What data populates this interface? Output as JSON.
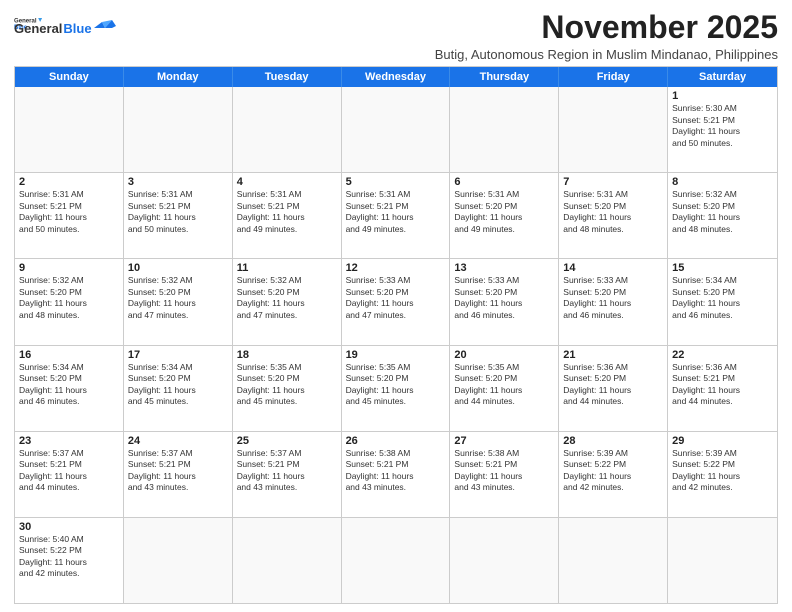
{
  "logo": {
    "line1": "General",
    "line2": "Blue"
  },
  "title": "November 2025",
  "subtitle": "Butig, Autonomous Region in Muslim Mindanao, Philippines",
  "header_days": [
    "Sunday",
    "Monday",
    "Tuesday",
    "Wednesday",
    "Thursday",
    "Friday",
    "Saturday"
  ],
  "weeks": [
    [
      {
        "day": "",
        "text": ""
      },
      {
        "day": "",
        "text": ""
      },
      {
        "day": "",
        "text": ""
      },
      {
        "day": "",
        "text": ""
      },
      {
        "day": "",
        "text": ""
      },
      {
        "day": "",
        "text": ""
      },
      {
        "day": "1",
        "text": "Sunrise: 5:30 AM\nSunset: 5:21 PM\nDaylight: 11 hours\nand 50 minutes."
      }
    ],
    [
      {
        "day": "2",
        "text": "Sunrise: 5:31 AM\nSunset: 5:21 PM\nDaylight: 11 hours\nand 50 minutes."
      },
      {
        "day": "3",
        "text": "Sunrise: 5:31 AM\nSunset: 5:21 PM\nDaylight: 11 hours\nand 50 minutes."
      },
      {
        "day": "4",
        "text": "Sunrise: 5:31 AM\nSunset: 5:21 PM\nDaylight: 11 hours\nand 49 minutes."
      },
      {
        "day": "5",
        "text": "Sunrise: 5:31 AM\nSunset: 5:21 PM\nDaylight: 11 hours\nand 49 minutes."
      },
      {
        "day": "6",
        "text": "Sunrise: 5:31 AM\nSunset: 5:20 PM\nDaylight: 11 hours\nand 49 minutes."
      },
      {
        "day": "7",
        "text": "Sunrise: 5:31 AM\nSunset: 5:20 PM\nDaylight: 11 hours\nand 48 minutes."
      },
      {
        "day": "8",
        "text": "Sunrise: 5:32 AM\nSunset: 5:20 PM\nDaylight: 11 hours\nand 48 minutes."
      }
    ],
    [
      {
        "day": "9",
        "text": "Sunrise: 5:32 AM\nSunset: 5:20 PM\nDaylight: 11 hours\nand 48 minutes."
      },
      {
        "day": "10",
        "text": "Sunrise: 5:32 AM\nSunset: 5:20 PM\nDaylight: 11 hours\nand 47 minutes."
      },
      {
        "day": "11",
        "text": "Sunrise: 5:32 AM\nSunset: 5:20 PM\nDaylight: 11 hours\nand 47 minutes."
      },
      {
        "day": "12",
        "text": "Sunrise: 5:33 AM\nSunset: 5:20 PM\nDaylight: 11 hours\nand 47 minutes."
      },
      {
        "day": "13",
        "text": "Sunrise: 5:33 AM\nSunset: 5:20 PM\nDaylight: 11 hours\nand 46 minutes."
      },
      {
        "day": "14",
        "text": "Sunrise: 5:33 AM\nSunset: 5:20 PM\nDaylight: 11 hours\nand 46 minutes."
      },
      {
        "day": "15",
        "text": "Sunrise: 5:34 AM\nSunset: 5:20 PM\nDaylight: 11 hours\nand 46 minutes."
      }
    ],
    [
      {
        "day": "16",
        "text": "Sunrise: 5:34 AM\nSunset: 5:20 PM\nDaylight: 11 hours\nand 46 minutes."
      },
      {
        "day": "17",
        "text": "Sunrise: 5:34 AM\nSunset: 5:20 PM\nDaylight: 11 hours\nand 45 minutes."
      },
      {
        "day": "18",
        "text": "Sunrise: 5:35 AM\nSunset: 5:20 PM\nDaylight: 11 hours\nand 45 minutes."
      },
      {
        "day": "19",
        "text": "Sunrise: 5:35 AM\nSunset: 5:20 PM\nDaylight: 11 hours\nand 45 minutes."
      },
      {
        "day": "20",
        "text": "Sunrise: 5:35 AM\nSunset: 5:20 PM\nDaylight: 11 hours\nand 44 minutes."
      },
      {
        "day": "21",
        "text": "Sunrise: 5:36 AM\nSunset: 5:20 PM\nDaylight: 11 hours\nand 44 minutes."
      },
      {
        "day": "22",
        "text": "Sunrise: 5:36 AM\nSunset: 5:21 PM\nDaylight: 11 hours\nand 44 minutes."
      }
    ],
    [
      {
        "day": "23",
        "text": "Sunrise: 5:37 AM\nSunset: 5:21 PM\nDaylight: 11 hours\nand 44 minutes."
      },
      {
        "day": "24",
        "text": "Sunrise: 5:37 AM\nSunset: 5:21 PM\nDaylight: 11 hours\nand 43 minutes."
      },
      {
        "day": "25",
        "text": "Sunrise: 5:37 AM\nSunset: 5:21 PM\nDaylight: 11 hours\nand 43 minutes."
      },
      {
        "day": "26",
        "text": "Sunrise: 5:38 AM\nSunset: 5:21 PM\nDaylight: 11 hours\nand 43 minutes."
      },
      {
        "day": "27",
        "text": "Sunrise: 5:38 AM\nSunset: 5:21 PM\nDaylight: 11 hours\nand 43 minutes."
      },
      {
        "day": "28",
        "text": "Sunrise: 5:39 AM\nSunset: 5:22 PM\nDaylight: 11 hours\nand 42 minutes."
      },
      {
        "day": "29",
        "text": "Sunrise: 5:39 AM\nSunset: 5:22 PM\nDaylight: 11 hours\nand 42 minutes."
      }
    ],
    [
      {
        "day": "30",
        "text": "Sunrise: 5:40 AM\nSunset: 5:22 PM\nDaylight: 11 hours\nand 42 minutes."
      },
      {
        "day": "",
        "text": ""
      },
      {
        "day": "",
        "text": ""
      },
      {
        "day": "",
        "text": ""
      },
      {
        "day": "",
        "text": ""
      },
      {
        "day": "",
        "text": ""
      },
      {
        "day": "",
        "text": ""
      }
    ]
  ]
}
